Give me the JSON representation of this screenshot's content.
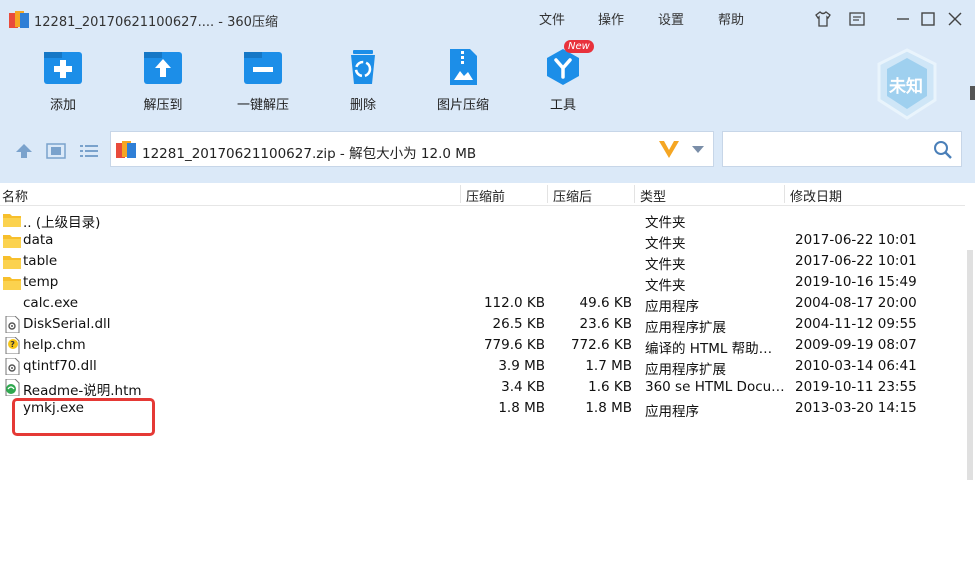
{
  "window": {
    "title": "12281_20170621100627.... - 360压缩",
    "menu": [
      "文件",
      "操作",
      "设置",
      "帮助"
    ]
  },
  "toolbar": {
    "buttons": [
      {
        "label": "添加",
        "icon": "add-icon"
      },
      {
        "label": "解压到",
        "icon": "extract-to-icon"
      },
      {
        "label": "一键解压",
        "icon": "one-click-extract-icon"
      },
      {
        "label": "删除",
        "icon": "delete-icon"
      },
      {
        "label": "图片压缩",
        "icon": "image-compress-icon"
      },
      {
        "label": "工具",
        "icon": "tools-icon"
      }
    ],
    "new_badge": "New",
    "shield_label": "未知"
  },
  "address": {
    "path": "12281_20170621100627.zip - 解包大小为 12.0 MB",
    "search_placeholder": ""
  },
  "columns": {
    "name": "名称",
    "size": "压缩前",
    "compressed": "压缩后",
    "type": "类型",
    "modified": "修改日期"
  },
  "files": [
    {
      "name": ".. (上级目录)",
      "size": "",
      "compressed": "",
      "type": "文件夹",
      "modified": "",
      "icon": "folder-icon"
    },
    {
      "name": "data",
      "size": "",
      "compressed": "",
      "type": "文件夹",
      "modified": "2017-06-22 10:01",
      "icon": "folder-icon"
    },
    {
      "name": "table",
      "size": "",
      "compressed": "",
      "type": "文件夹",
      "modified": "2017-06-22 10:01",
      "icon": "folder-icon"
    },
    {
      "name": "temp",
      "size": "",
      "compressed": "",
      "type": "文件夹",
      "modified": "2019-10-16 15:49",
      "icon": "folder-icon"
    },
    {
      "name": "calc.exe",
      "size": "112.0 KB",
      "compressed": "49.6 KB",
      "type": "应用程序",
      "modified": "2004-08-17 20:00",
      "icon": "none"
    },
    {
      "name": "DiskSerial.dll",
      "size": "26.5 KB",
      "compressed": "23.6 KB",
      "type": "应用程序扩展",
      "modified": "2004-11-12 09:55",
      "icon": "dll-icon"
    },
    {
      "name": "help.chm",
      "size": "779.6 KB",
      "compressed": "772.6 KB",
      "type": "编译的 HTML 帮助…",
      "modified": "2009-09-19 08:07",
      "icon": "chm-icon"
    },
    {
      "name": "qtintf70.dll",
      "size": "3.9 MB",
      "compressed": "1.7 MB",
      "type": "应用程序扩展",
      "modified": "2010-03-14 06:41",
      "icon": "dll-icon"
    },
    {
      "name": "Readme-说明.htm",
      "size": "3.4 KB",
      "compressed": "1.6 KB",
      "type": "360 se HTML Docu…",
      "modified": "2019-10-11 23:55",
      "icon": "htm-icon"
    },
    {
      "name": "ymkj.exe",
      "size": "1.8 MB",
      "compressed": "1.8 MB",
      "type": "应用程序",
      "modified": "2013-03-20 14:15",
      "icon": "none"
    }
  ],
  "colors": {
    "accent": "#1c8ee8",
    "toolbar_bg": "#dbe9f8",
    "highlight": "#e53935"
  }
}
